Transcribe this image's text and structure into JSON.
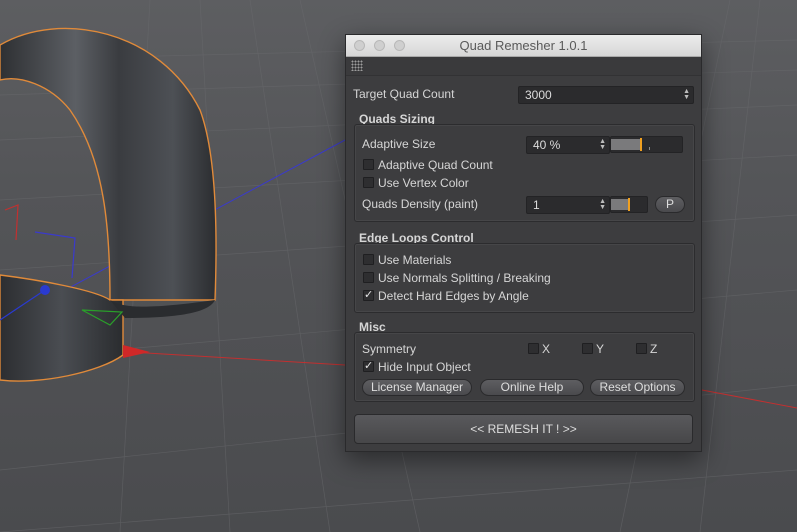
{
  "window": {
    "title": "Quad Remesher 1.0.1"
  },
  "target": {
    "label": "Target Quad Count",
    "value": "3000"
  },
  "quads_sizing": {
    "title": "Quads Sizing",
    "adaptive_size_label": "Adaptive Size",
    "adaptive_size_value": "40 %",
    "adaptive_size_level": 0.42,
    "adaptive_quad_count_label": "Adaptive Quad Count",
    "adaptive_quad_count_checked": false,
    "use_vertex_color_label": "Use Vertex Color",
    "use_vertex_color_checked": false,
    "density_label": "Quads Density (paint)",
    "density_value": "1",
    "density_level": 0.5,
    "paint_button": "P"
  },
  "edge_loops": {
    "title": "Edge Loops Control",
    "use_materials_label": "Use Materials",
    "use_materials_checked": false,
    "use_normals_label": "Use Normals Splitting / Breaking",
    "use_normals_checked": false,
    "detect_hard_edges_label": "Detect Hard Edges by Angle",
    "detect_hard_edges_checked": true
  },
  "misc": {
    "title": "Misc",
    "symmetry_label": "Symmetry",
    "sym_x": "X",
    "sym_y": "Y",
    "sym_z": "Z",
    "hide_input_label": "Hide Input Object",
    "hide_input_checked": true,
    "license_button": "License Manager",
    "help_button": "Online Help",
    "reset_button": "Reset Options"
  },
  "remesh_button": "<<   REMESH IT !   >>",
  "colors": {
    "accent": "#f0a020",
    "panel": "#3d3d3f",
    "object_outline": "#e08a3a"
  }
}
